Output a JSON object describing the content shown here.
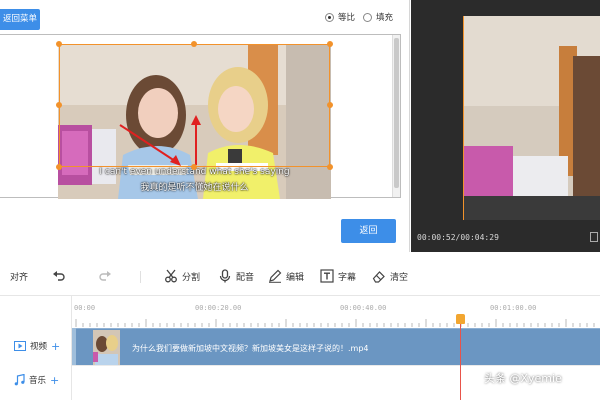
{
  "editor": {
    "back_menu_label": "返回菜单",
    "ratio_options": [
      {
        "label": "等比",
        "checked": true
      },
      {
        "label": "填充",
        "checked": false
      }
    ],
    "subtitle_lines": [
      "I can't even understand what she's saying",
      "我真的是听不懂她在说什么"
    ],
    "confirm_label": "返回"
  },
  "preview": {
    "time_text": "00:00:52/00:04:29"
  },
  "toolbar": {
    "align_label": "对齐",
    "items": [
      {
        "label": "分割",
        "icon": "scissors-icon"
      },
      {
        "label": "配音",
        "icon": "microphone-icon"
      },
      {
        "label": "编辑",
        "icon": "pencil-icon"
      },
      {
        "label": "字幕",
        "icon": "text-t-icon"
      },
      {
        "label": "清空",
        "icon": "eraser-icon"
      }
    ]
  },
  "timeline": {
    "ticks": [
      "00:00",
      "00:00:20.00",
      "00:00:40.00",
      "00:01:00.00"
    ],
    "tracks": {
      "video_label": "视频",
      "audio_label": "音乐"
    },
    "clip_title": "为什么我们要做新加坡中文视频？新加坡美女是这样子说的！.mp4"
  },
  "watermark": "头条 @Xyemie",
  "colors": {
    "accent": "#3d8ee8",
    "crop_orange": "#f2922b",
    "playhead": "#e8534a",
    "clip": "#6b96c2"
  }
}
